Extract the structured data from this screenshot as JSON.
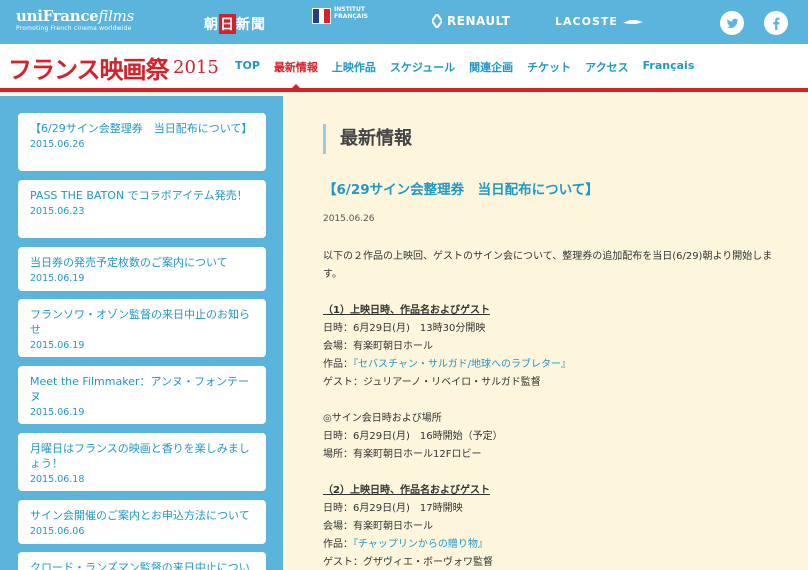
{
  "sponsors": {
    "unifrance_main": "uniFrance",
    "unifrance_italic": "films",
    "unifrance_sub": "Promoting French cinema worldwide",
    "asahi_left": "朝",
    "asahi_mid": "日",
    "asahi_right": "新聞",
    "institut_line1": "INSTITUT",
    "institut_line2": "FRANÇAIS",
    "renault": "RENAULT",
    "lacoste": "LACOSTE"
  },
  "header": {
    "site_title": "フランス映画祭",
    "year": "2015"
  },
  "nav": [
    {
      "label": "TOP"
    },
    {
      "label": "最新情報"
    },
    {
      "label": "上映作品"
    },
    {
      "label": "スケジュール"
    },
    {
      "label": "関連企画"
    },
    {
      "label": "チケット"
    },
    {
      "label": "アクセス"
    },
    {
      "label": "Français"
    }
  ],
  "sidebar": [
    {
      "title": "【6/29サイン会整理券　当日配布について】",
      "date": "2015.06.26"
    },
    {
      "title": "PASS THE BATON でコラボアイテム発売！",
      "date": "2015.06.23"
    },
    {
      "title": "当日券の発売予定枚数のご案内について",
      "date": "2015.06.19"
    },
    {
      "title": "フランソワ・オゾン監督の来日中止のお知らせ",
      "date": "2015.06.19"
    },
    {
      "title": "Meet the Filmmaker：アンヌ・フォンテーヌ",
      "date": "2015.06.19"
    },
    {
      "title": "月曜日はフランスの映画と香りを楽しみましょう！",
      "date": "2015.06.18"
    },
    {
      "title": "サイン会開催のご案内とお申込方法について",
      "date": "2015.06.06"
    },
    {
      "title": "クロード・ランズマン監督の来日中止につい",
      "date": ""
    }
  ],
  "main": {
    "page_heading": "最新情報",
    "article_title": "【6/29サイン会整理券　当日配布について】",
    "article_date": "2015.06.26",
    "intro": "以下の２作品の上映回、ゲストのサイン会について、整理券の追加配布を当日(6/29)朝より開始します。",
    "s1_title": "（1）上映日時、作品名およびゲスト",
    "s1_date": "日時：6月29日(月)　13時30分開映",
    "s1_venue": "会場：有楽町朝日ホール",
    "s1_work_prefix": "作品：",
    "s1_work_link": "『セバスチャン・サルガド/地球へのラブレター』",
    "s1_guest": "ゲスト：ジュリアーノ・リベイロ・サルガド監督",
    "sign_title": "◎サイン会日時および場所",
    "sign_date": "日時：6月29日(月)　16時開始（予定）",
    "sign_place": "場所：有楽町朝日ホール12Fロビー",
    "s2_title": "（2）上映日時、作品名およびゲスト",
    "s2_date": "日時：6月29日(月)　17時開映",
    "s2_venue": "会場：有楽町朝日ホール",
    "s2_work_prefix": "作品：",
    "s2_work_link": "『チャップリンからの贈り物』",
    "s2_guest": "ゲスト：グザヴィエ・ボーヴォワ監督"
  },
  "colors": {
    "sky": "#5ab4dc",
    "red": "#d7202a",
    "link": "#1f97c7",
    "cream": "#fdf6dc"
  }
}
